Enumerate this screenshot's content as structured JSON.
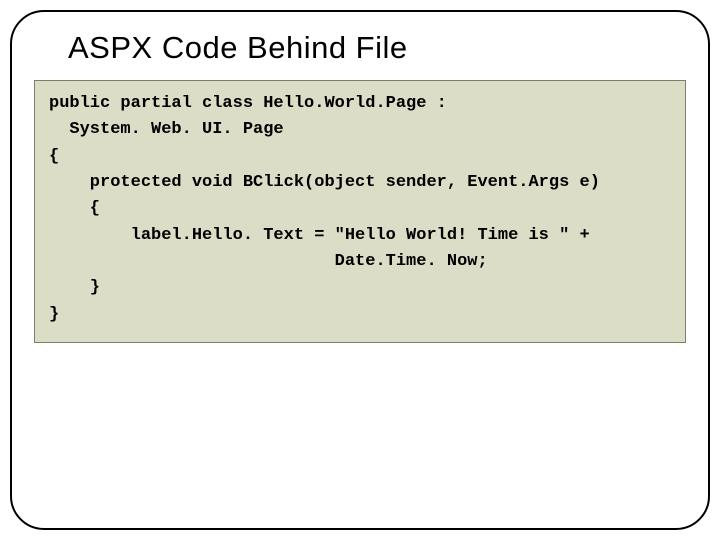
{
  "title": "ASPX Code Behind File",
  "code": "public partial class Hello.World.Page :\n  System. Web. UI. Page\n{\n    protected void BClick(object sender, Event.Args e)\n    {\n        label.Hello. Text = \"Hello World! Time is \" +\n                            Date.Time. Now;\n    }\n}"
}
